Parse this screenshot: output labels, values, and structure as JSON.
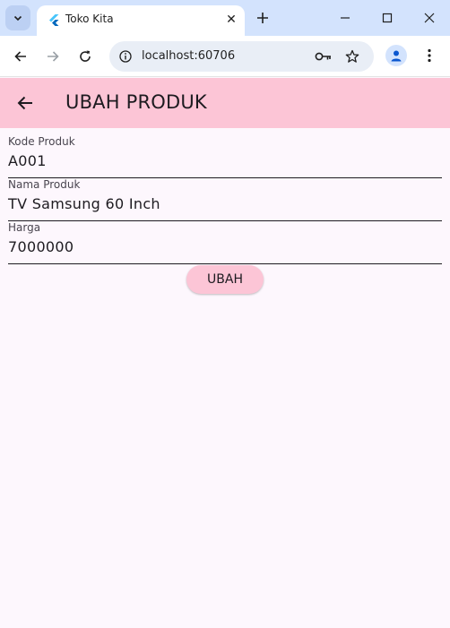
{
  "browser": {
    "tab_title": "Toko Kita",
    "tab_close_glyph": "✕",
    "new_tab_glyph": "+",
    "url": "localhost:60706",
    "icons": [
      "tab-search-icon",
      "flutter-icon",
      "close-icon",
      "plus-icon",
      "minimize-icon",
      "maximize-icon",
      "close-window-icon",
      "back-icon",
      "forward-icon",
      "reload-icon",
      "info-icon",
      "key-icon",
      "star-icon",
      "profile-icon",
      "more-vert-icon"
    ]
  },
  "appbar": {
    "title": "UBAH PRODUK",
    "color": "#fcc5d6"
  },
  "form": {
    "fields": [
      {
        "label": "Kode Produk",
        "value": "A001"
      },
      {
        "label": "Nama Produk",
        "value": "TV Samsung 60 Inch"
      },
      {
        "label": "Harga",
        "value": "7000000"
      }
    ],
    "submit_label": "UBAH"
  },
  "colors": {
    "tabstrip": "#d3e3fd",
    "page_background": "#fdf7fd",
    "button": "#fcc5d6"
  }
}
